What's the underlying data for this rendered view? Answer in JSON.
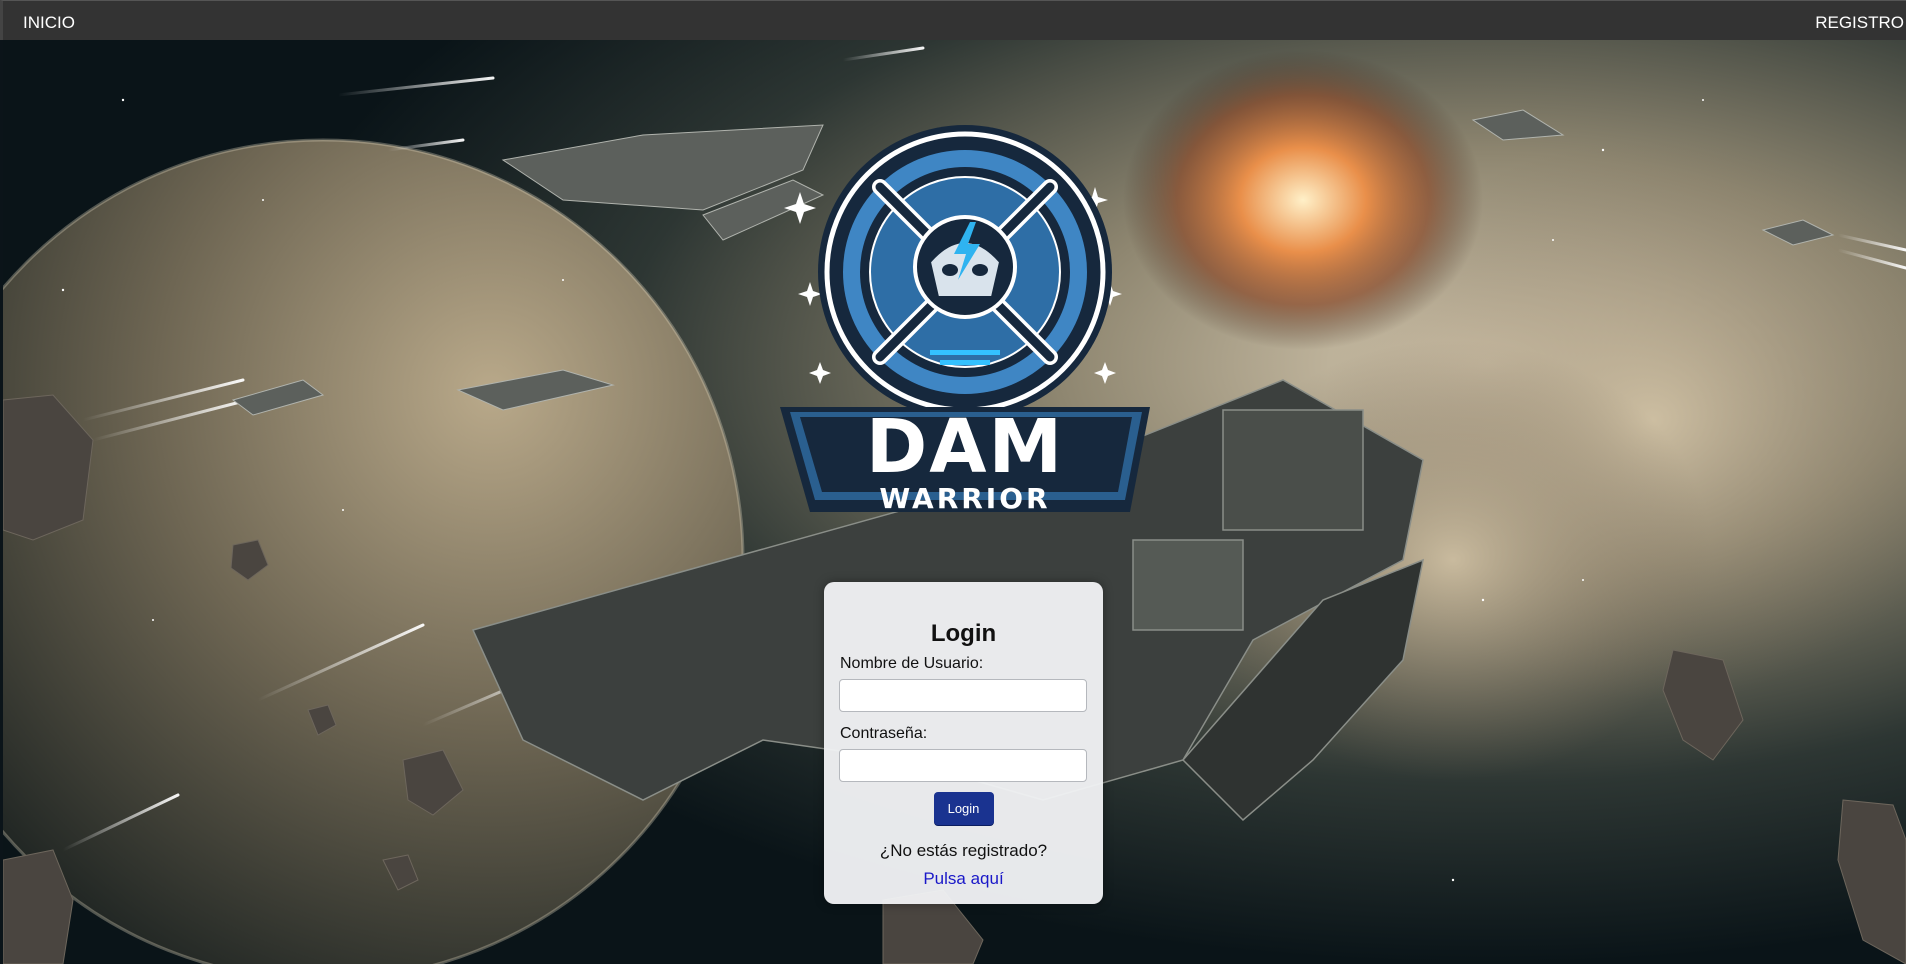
{
  "nav": {
    "home_label": "INICIO",
    "register_label": "REGISTRO"
  },
  "logo": {
    "main_text": "DAM",
    "sub_text": "WARRIOR"
  },
  "login": {
    "title": "Login",
    "username_label": "Nombre de Usuario:",
    "username_value": "",
    "password_label": "Contraseña:",
    "password_value": "",
    "submit_label": "Login",
    "not_registered_text": "¿No estás registrado?",
    "register_link": "Pulsa aquí"
  },
  "colors": {
    "topbar": "#333333",
    "button": "#1a3390",
    "link": "#1a18c8",
    "logo_blue": "#3f86c4",
    "logo_navy": "#16283d"
  }
}
